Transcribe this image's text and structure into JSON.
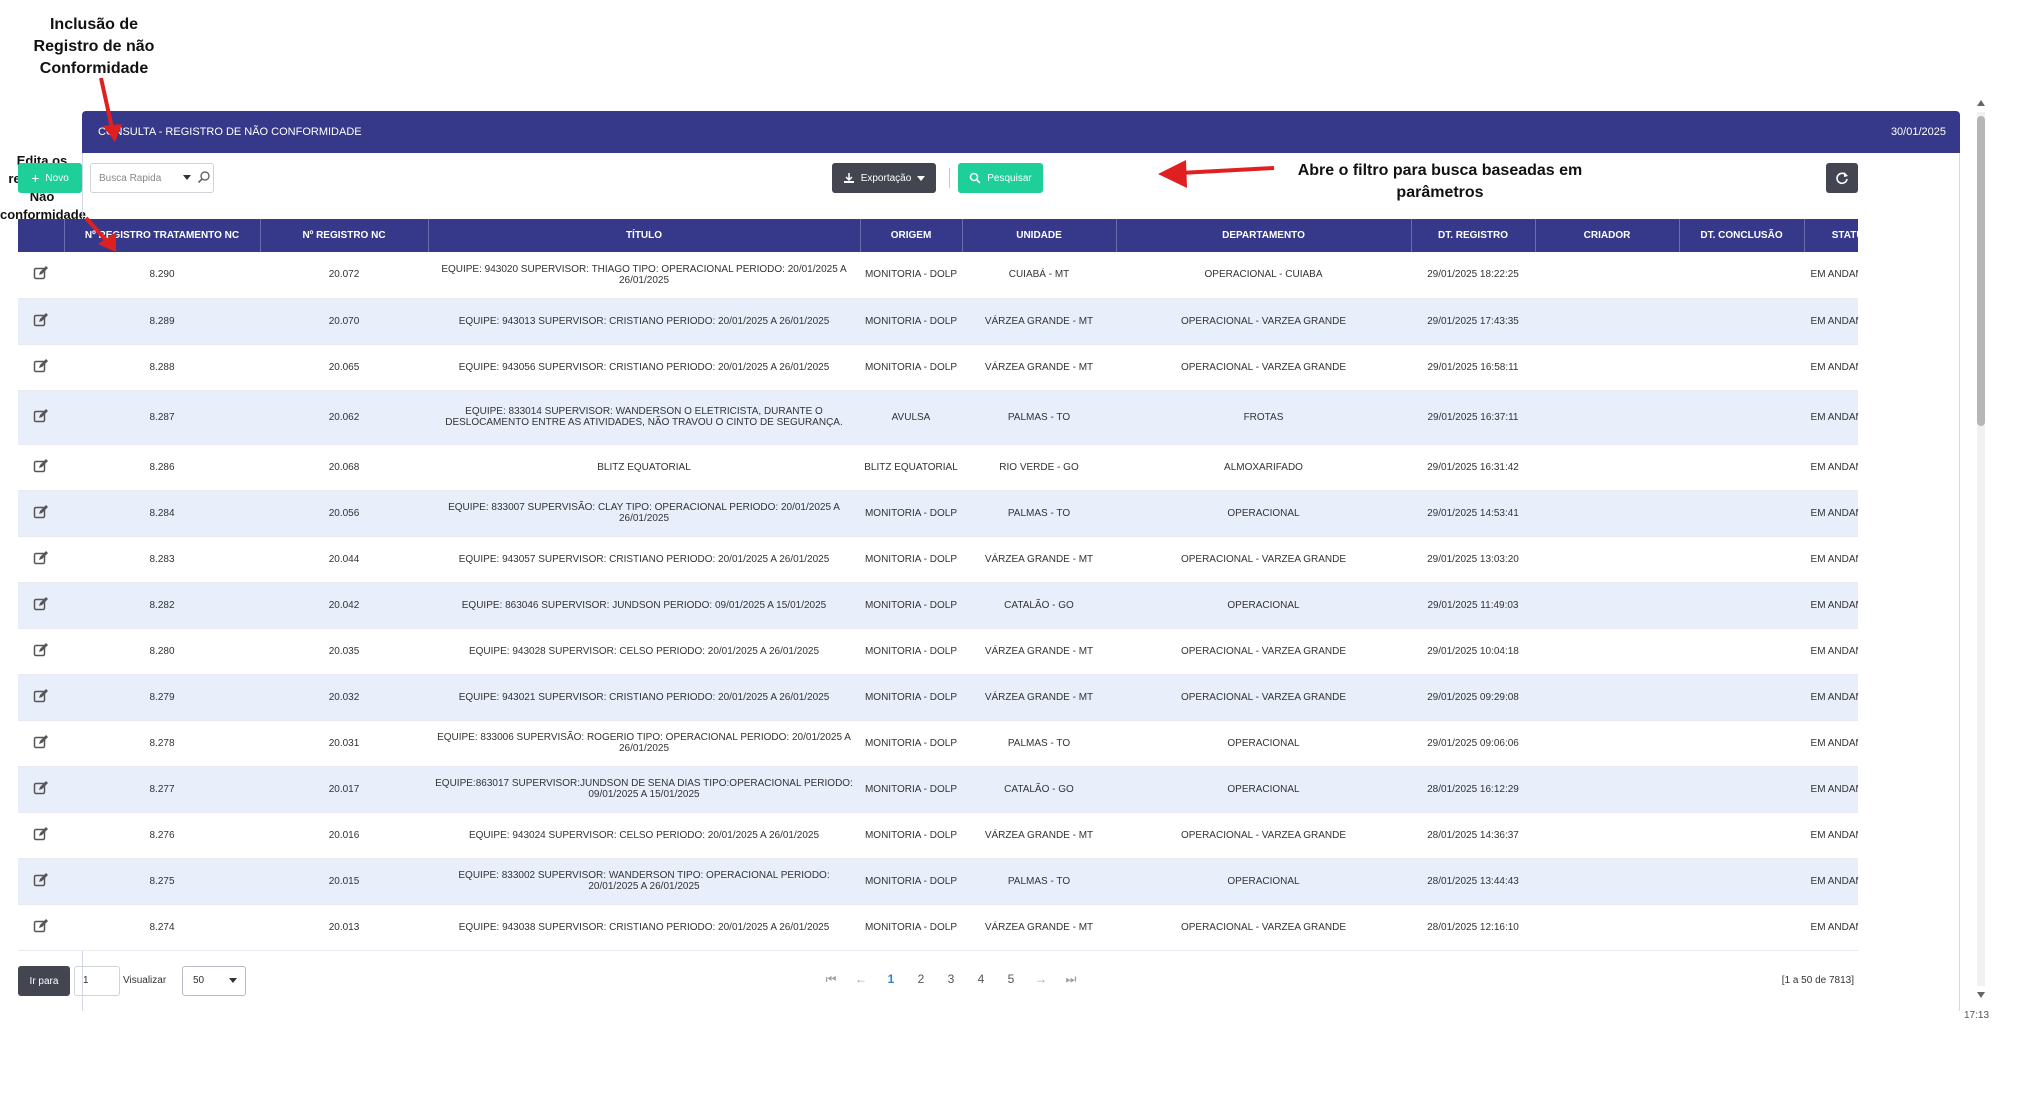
{
  "annotations": {
    "new": "Inclusão de Registro de não Conformidade",
    "edit": "Edita os registro de Não conformidade",
    "filter": "Abre o filtro para busca baseadas em parâmetros"
  },
  "header": {
    "title": "CONSULTA - REGISTRO DE NÃO CONFORMIDADE",
    "date": "30/01/2025"
  },
  "toolbar": {
    "new_label": "Novo",
    "search_placeholder": "Busca Rapida",
    "export_label": "Exportação",
    "search_label": "Pesquisar"
  },
  "table": {
    "columns": [
      "",
      "Nº REGISTRO TRATAMENTO NC",
      "Nº REGISTRO NC",
      "TÍTULO",
      "ORIGEM",
      "UNIDADE",
      "DEPARTAMENTO",
      "DT. REGISTRO",
      "CRIADOR",
      "DT. CONCLUSÃO",
      "STATUS"
    ],
    "rows": [
      [
        "8.290",
        "20.072",
        "EQUIPE: 943020 SUPERVISOR: THIAGO TIPO: OPERACIONAL PERIODO: 20/01/2025 A 26/01/2025",
        "MONITORIA - DOLP",
        "CUIABÁ - MT",
        "OPERACIONAL - CUIABA",
        "29/01/2025 18:22:25",
        "",
        "",
        "EM ANDAMENTO"
      ],
      [
        "8.289",
        "20.070",
        "EQUIPE: 943013 SUPERVISOR: CRISTIANO PERIODO: 20/01/2025 A 26/01/2025",
        "MONITORIA - DOLP",
        "VÁRZEA GRANDE - MT",
        "OPERACIONAL - VARZEA GRANDE",
        "29/01/2025 17:43:35",
        "",
        "",
        "EM ANDAMENTO"
      ],
      [
        "8.288",
        "20.065",
        "EQUIPE: 943056 SUPERVISOR: CRISTIANO PERIODO: 20/01/2025 A 26/01/2025",
        "MONITORIA - DOLP",
        "VÁRZEA GRANDE - MT",
        "OPERACIONAL - VARZEA GRANDE",
        "29/01/2025 16:58:11",
        "",
        "",
        "EM ANDAMENTO"
      ],
      [
        "8.287",
        "20.062",
        "EQUIPE: 833014 SUPERVISOR: WANDERSON O ELETRICISTA, DURANTE O DESLOCAMENTO ENTRE AS ATIVIDADES, NÃO TRAVOU O CINTO DE SEGURANÇA.",
        "AVULSA",
        "PALMAS - TO",
        "FROTAS",
        "29/01/2025 16:37:11",
        "",
        "",
        "EM ANDAMENTO"
      ],
      [
        "8.286",
        "20.068",
        "BLITZ EQUATORIAL",
        "BLITZ EQUATORIAL",
        "RIO VERDE - GO",
        "ALMOXARIFADO",
        "29/01/2025 16:31:42",
        "",
        "",
        "EM ANDAMENTO"
      ],
      [
        "8.284",
        "20.056",
        "EQUIPE: 833007 SUPERVISÃO: CLAY TIPO: OPERACIONAL PERIODO: 20/01/2025 A 26/01/2025",
        "MONITORIA - DOLP",
        "PALMAS - TO",
        "OPERACIONAL",
        "29/01/2025 14:53:41",
        "",
        "",
        "EM ANDAMENTO"
      ],
      [
        "8.283",
        "20.044",
        "EQUIPE: 943057 SUPERVISOR: CRISTIANO PERIODO: 20/01/2025 A 26/01/2025",
        "MONITORIA - DOLP",
        "VÁRZEA GRANDE - MT",
        "OPERACIONAL - VARZEA GRANDE",
        "29/01/2025 13:03:20",
        "",
        "",
        "EM ANDAMENTO"
      ],
      [
        "8.282",
        "20.042",
        "EQUIPE: 863046 SUPERVISOR: JUNDSON PERIODO: 09/01/2025 A 15/01/2025",
        "MONITORIA - DOLP",
        "CATALÃO - GO",
        "OPERACIONAL",
        "29/01/2025 11:49:03",
        "",
        "",
        "EM ANDAMENTO"
      ],
      [
        "8.280",
        "20.035",
        "EQUIPE: 943028 SUPERVISOR: CELSO PERIODO: 20/01/2025 A 26/01/2025",
        "MONITORIA - DOLP",
        "VÁRZEA GRANDE - MT",
        "OPERACIONAL - VARZEA GRANDE",
        "29/01/2025 10:04:18",
        "",
        "",
        "EM ANDAMENTO"
      ],
      [
        "8.279",
        "20.032",
        "EQUIPE: 943021 SUPERVISOR: CRISTIANO PERIODO: 20/01/2025 A 26/01/2025",
        "MONITORIA - DOLP",
        "VÁRZEA GRANDE - MT",
        "OPERACIONAL - VARZEA GRANDE",
        "29/01/2025 09:29:08",
        "",
        "",
        "EM ANDAMENTO"
      ],
      [
        "8.278",
        "20.031",
        "EQUIPE: 833006 SUPERVISÃO: ROGERIO TIPO: OPERACIONAL PERIODO: 20/01/2025 A 26/01/2025",
        "MONITORIA - DOLP",
        "PALMAS - TO",
        "OPERACIONAL",
        "29/01/2025 09:06:06",
        "",
        "",
        "EM ANDAMENTO"
      ],
      [
        "8.277",
        "20.017",
        "EQUIPE:863017 SUPERVISOR:JUNDSON DE SENA DIAS TIPO:OPERACIONAL PERIODO: 09/01/2025 A 15/01/2025",
        "MONITORIA - DOLP",
        "CATALÃO - GO",
        "OPERACIONAL",
        "28/01/2025 16:12:29",
        "",
        "",
        "EM ANDAMENTO"
      ],
      [
        "8.276",
        "20.016",
        "EQUIPE: 943024 SUPERVISOR: CELSO PERIODO: 20/01/2025 A 26/01/2025",
        "MONITORIA - DOLP",
        "VÁRZEA GRANDE - MT",
        "OPERACIONAL - VARZEA GRANDE",
        "28/01/2025 14:36:37",
        "",
        "",
        "EM ANDAMENTO"
      ],
      [
        "8.275",
        "20.015",
        "EQUIPE: 833002 SUPERVISOR: WANDERSON TIPO: OPERACIONAL PERIODO: 20/01/2025 A 26/01/2025",
        "MONITORIA - DOLP",
        "PALMAS - TO",
        "OPERACIONAL",
        "28/01/2025 13:44:43",
        "",
        "",
        "EM ANDAMENTO"
      ],
      [
        "8.274",
        "20.013",
        "EQUIPE: 943038 SUPERVISOR: CRISTIANO PERIODO: 20/01/2025 A 26/01/2025",
        "MONITORIA - DOLP",
        "VÁRZEA GRANDE - MT",
        "OPERACIONAL - VARZEA GRANDE",
        "28/01/2025 12:16:10",
        "",
        "",
        "EM ANDAMENTO"
      ]
    ]
  },
  "pager": {
    "goto_label": "Ir para",
    "goto_value": "1",
    "view_label": "Visualizar",
    "view_value": "50",
    "first": "⏮",
    "prev": "←",
    "next": "→",
    "last": "⏭",
    "pages": [
      "1",
      "2",
      "3",
      "4",
      "5"
    ],
    "current": "1",
    "total": "[1 a 50 de 7813]"
  },
  "clock": "17:13",
  "colors": {
    "header": "#36398a",
    "accent": "#1fcf9a",
    "dark_button": "#434651",
    "row_alt": "#e9eefb",
    "arrow": "#e02020"
  }
}
